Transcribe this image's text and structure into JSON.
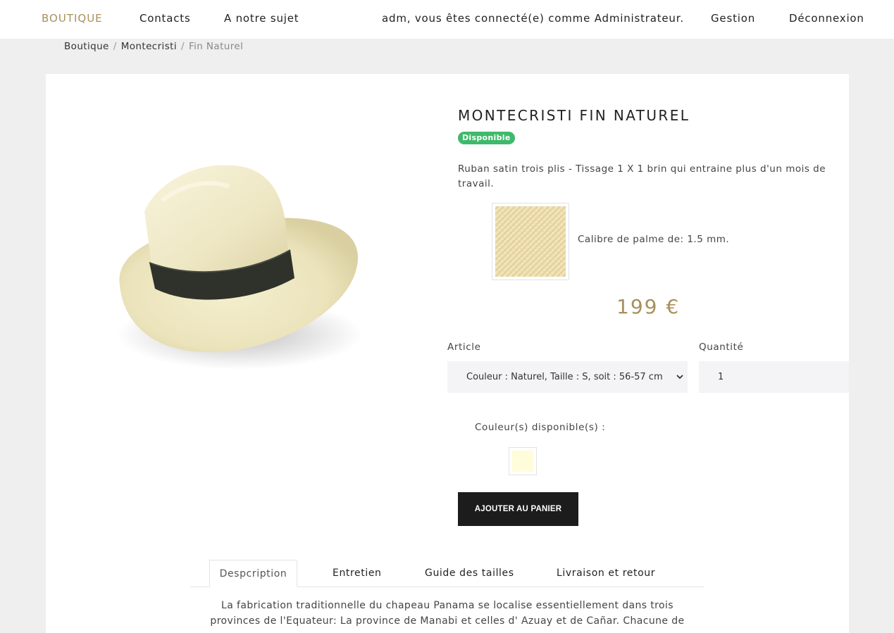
{
  "nav": {
    "brand": "BOUTIQUE",
    "contacts": "Contacts",
    "about": "A notre sujet",
    "user_status": "adm, vous êtes connecté(e) comme Administrateur.",
    "manage": "Gestion",
    "logout": "Déconnexion"
  },
  "breadcrumb": {
    "items": [
      "Boutique",
      "Montecristi"
    ],
    "current": "Fin Naturel",
    "separator": "/"
  },
  "product": {
    "title": "MONTECRISTI FIN NATUREL",
    "badge": "Disponible",
    "summary": "Ruban satin trois plis - Tissage 1 X 1 brin qui entraine plus d'un mois de travail.",
    "caliber": "Calibre de palme de: 1.5 mm.",
    "price": "199 €",
    "article_label": "Article",
    "article_selected": "Couleur : Naturel, Taille : S, soit : 56-57 cm",
    "quantity_label": "Quantité",
    "quantity_value": "1",
    "colors_label": "Couleur(s) disponible(s) :",
    "color_swatch": "#fffdd9",
    "add_to_cart": "AJOUTER AU PANIER"
  },
  "tabs": {
    "items": [
      "Despcription",
      "Entretien",
      "Guide des tailles",
      "Livraison et retour"
    ],
    "active": "Despcription"
  },
  "description": "La fabrication traditionnelle du chapeau Panama se localise essentiellement dans trois provinces de l'Equateur: La province de Manabi et celles d' Azuay et de Cañar. Chacune de ces",
  "colors": {
    "accent": "#a7905c",
    "badge": "#3fb96b",
    "button": "#1c1c1c",
    "page_bg": "#efeff0"
  }
}
